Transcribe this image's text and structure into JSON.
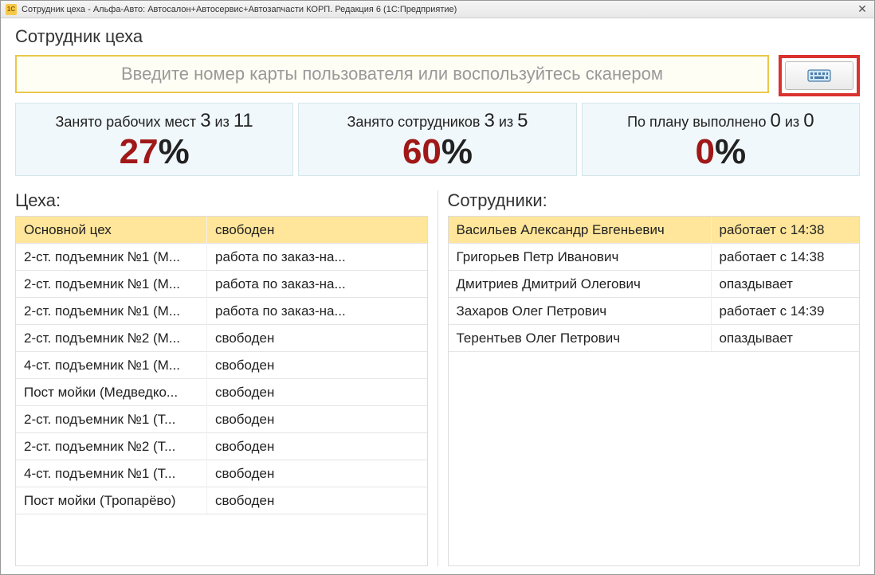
{
  "titlebar": {
    "icon_label": "1C",
    "text": "Сотрудник цеха - Альфа-Авто: Автосалон+Автосервис+Автозапчасти КОРП. Редакция 6  (1С:Предприятие)"
  },
  "page_title": "Сотрудник цеха",
  "input": {
    "placeholder": "Введите номер карты пользователя или воспользуйтесь сканером"
  },
  "stats": [
    {
      "label_prefix": "Занято рабочих мест ",
      "n1": "3",
      "mid": " из ",
      "n2": "11",
      "value": "27",
      "suffix": "%"
    },
    {
      "label_prefix": "Занято сотрудников ",
      "n1": "3",
      "mid": " из ",
      "n2": "5",
      "value": "60",
      "suffix": "%"
    },
    {
      "label_prefix": "По плану выполнено ",
      "n1": "0",
      "mid": " из ",
      "n2": "0",
      "value": "0",
      "suffix": "%"
    }
  ],
  "workshops": {
    "title": "Цеха:",
    "rows": [
      {
        "name": "Основной цех",
        "status": "свободен",
        "header": true
      },
      {
        "name": "2-ст. подъемник №1 (М...",
        "status": "работа по заказ-на..."
      },
      {
        "name": "2-ст. подъемник №1 (М...",
        "status": "работа по заказ-на..."
      },
      {
        "name": "2-ст. подъемник №1 (М...",
        "status": "работа по заказ-на..."
      },
      {
        "name": "2-ст. подъемник №2 (М...",
        "status": "свободен"
      },
      {
        "name": "4-ст. подъемник №1 (М...",
        "status": "свободен"
      },
      {
        "name": "Пост мойки (Медведко...",
        "status": "свободен"
      },
      {
        "name": "2-ст. подъемник №1 (Т...",
        "status": "свободен"
      },
      {
        "name": "2-ст. подъемник №2 (Т...",
        "status": "свободен"
      },
      {
        "name": "4-ст. подъемник №1 (Т...",
        "status": "свободен"
      },
      {
        "name": "Пост мойки (Тропарёво)",
        "status": "свободен"
      }
    ]
  },
  "employees": {
    "title": "Сотрудники:",
    "rows": [
      {
        "name": "Васильев Александр Евгеньевич",
        "status": "работает с 14:38",
        "header": true
      },
      {
        "name": "Григорьев Петр Иванович",
        "status": "работает с 14:38"
      },
      {
        "name": "Дмитриев Дмитрий Олегович",
        "status": "опаздывает"
      },
      {
        "name": "Захаров Олег Петрович",
        "status": "работает с 14:39"
      },
      {
        "name": "Терентьев Олег Петрович",
        "status": "опаздывает"
      }
    ]
  }
}
